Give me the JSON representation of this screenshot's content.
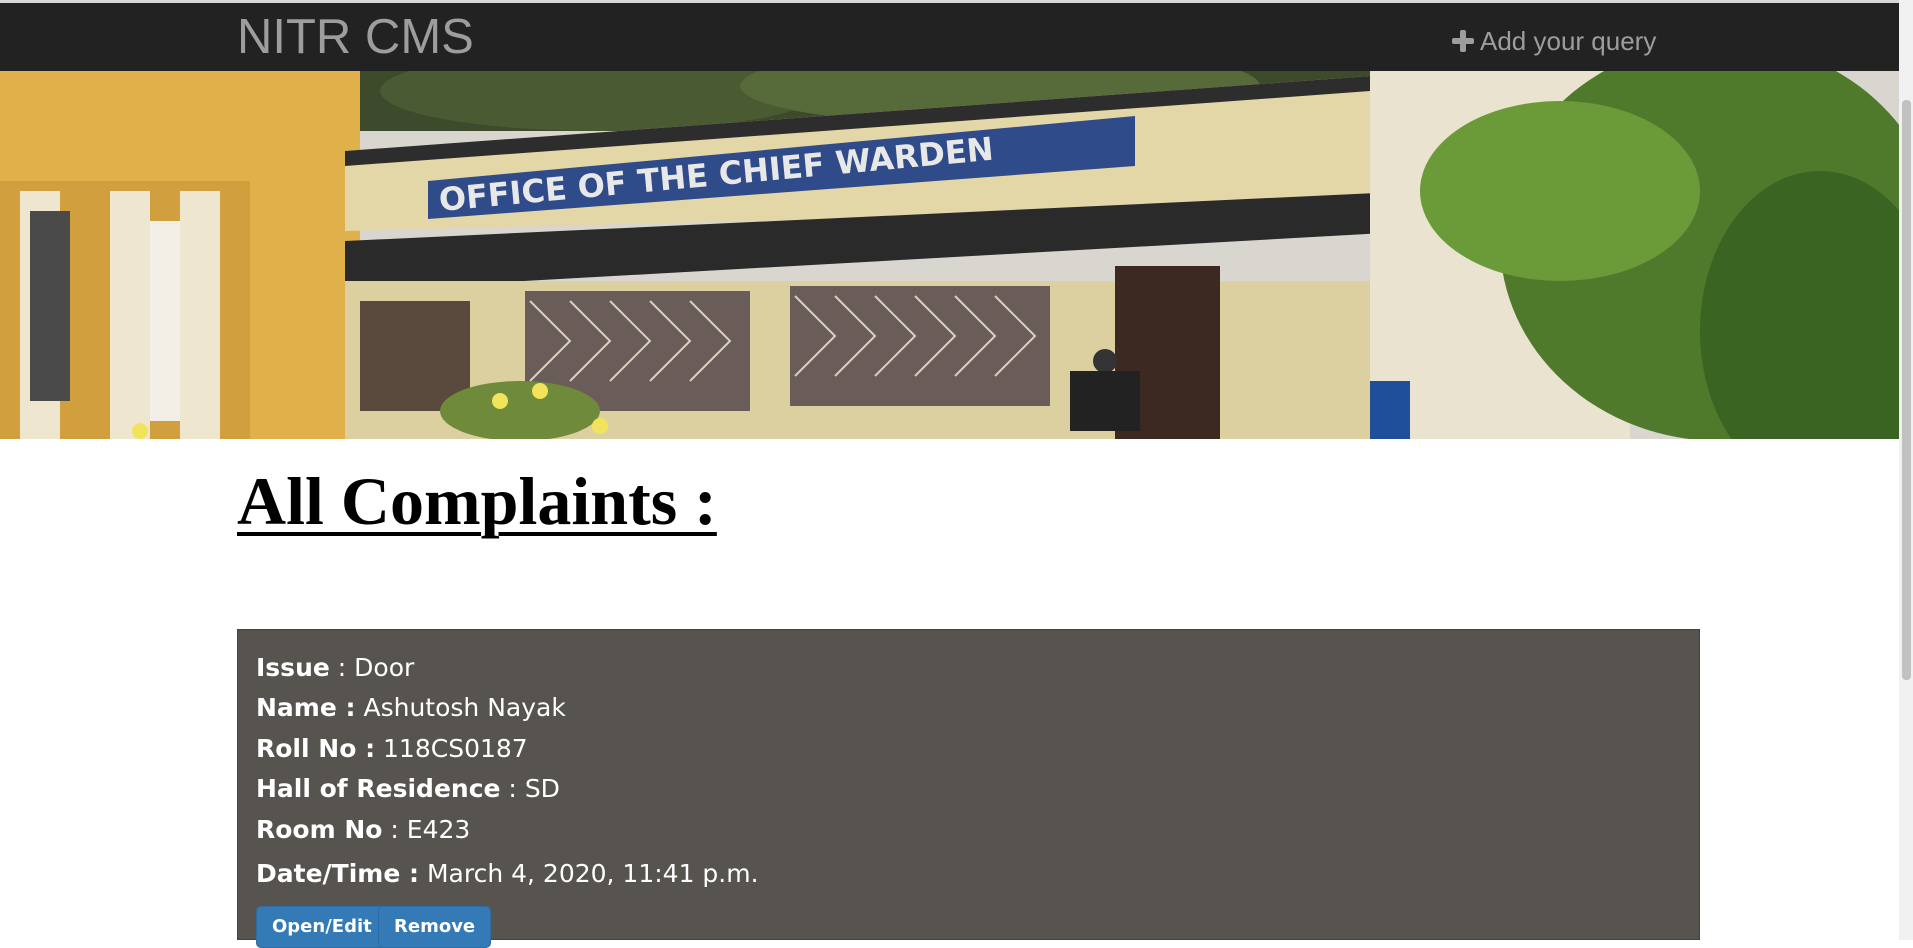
{
  "navbar": {
    "brand": "NITR CMS",
    "add_query": {
      "icon": "plus-icon",
      "label": "Add your query"
    }
  },
  "banner": {
    "sign_text": "OFFICE OF THE CHIEF WARDEN"
  },
  "heading": "All Complaints :",
  "complaint": {
    "fields": [
      {
        "label": "Issue",
        "value": "Door"
      },
      {
        "label": "Name",
        "value": "Ashutosh Nayak"
      },
      {
        "label": "Roll No",
        "value": "118CS0187"
      },
      {
        "label": "Hall of Residence",
        "value": "SD"
      },
      {
        "label": "Room No",
        "value": "E423"
      },
      {
        "label": "Date/Time",
        "value": "March 4, 2020, 11:41 p.m."
      }
    ],
    "actions": {
      "open_edit": "Open/Edit",
      "remove": "Remove"
    }
  },
  "colors": {
    "navbar": "#222222",
    "card": "#57534f",
    "button": "#337ab7"
  }
}
